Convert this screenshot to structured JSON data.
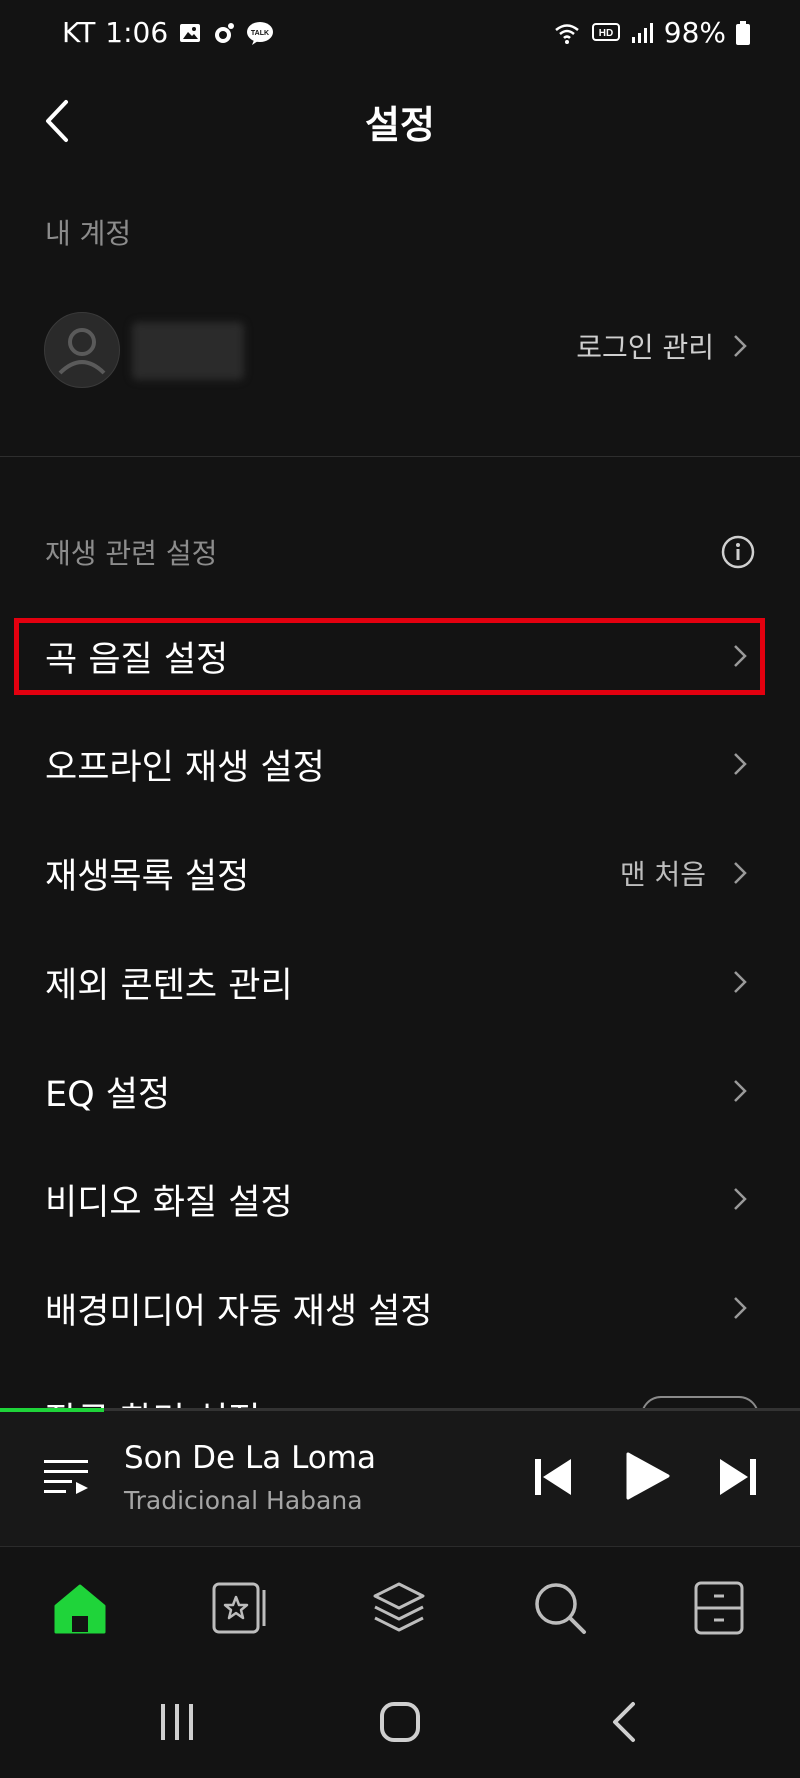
{
  "status_bar": {
    "carrier": "KT",
    "time": "1:06",
    "battery": "98%",
    "hd_badge": "HD",
    "talk_badge": "TALK"
  },
  "header": {
    "title": "설정"
  },
  "account": {
    "section_label": "내 계정",
    "login_manage_label": "로그인 관리"
  },
  "playback": {
    "section_label": "재생 관련 설정",
    "rows": [
      {
        "label": "곡 음질 설정",
        "value": ""
      },
      {
        "label": "오프라인 재생 설정",
        "value": ""
      },
      {
        "label": "재생목록 설정",
        "value": "맨 처음"
      },
      {
        "label": "제외 콘텐츠 관리",
        "value": ""
      },
      {
        "label": "EQ 설정",
        "value": ""
      },
      {
        "label": "비디오 화질 설정",
        "value": ""
      },
      {
        "label": "배경미디어 자동 재생 설정",
        "value": ""
      },
      {
        "label": "잠금 화면 설정",
        "value": ""
      }
    ]
  },
  "player": {
    "title": "Son De La Loma",
    "artist": "Tradicional Habana",
    "progress": 0.13
  },
  "bottom_nav": {
    "items": [
      {
        "icon": "home-icon",
        "active": true
      },
      {
        "icon": "my-library-icon",
        "active": false
      },
      {
        "icon": "layers-icon",
        "active": false
      },
      {
        "icon": "search-icon",
        "active": false
      },
      {
        "icon": "locker-icon",
        "active": false
      }
    ]
  },
  "colors": {
    "accent": "#1fd43a",
    "highlight": "#e3000f",
    "background": "#131313"
  }
}
